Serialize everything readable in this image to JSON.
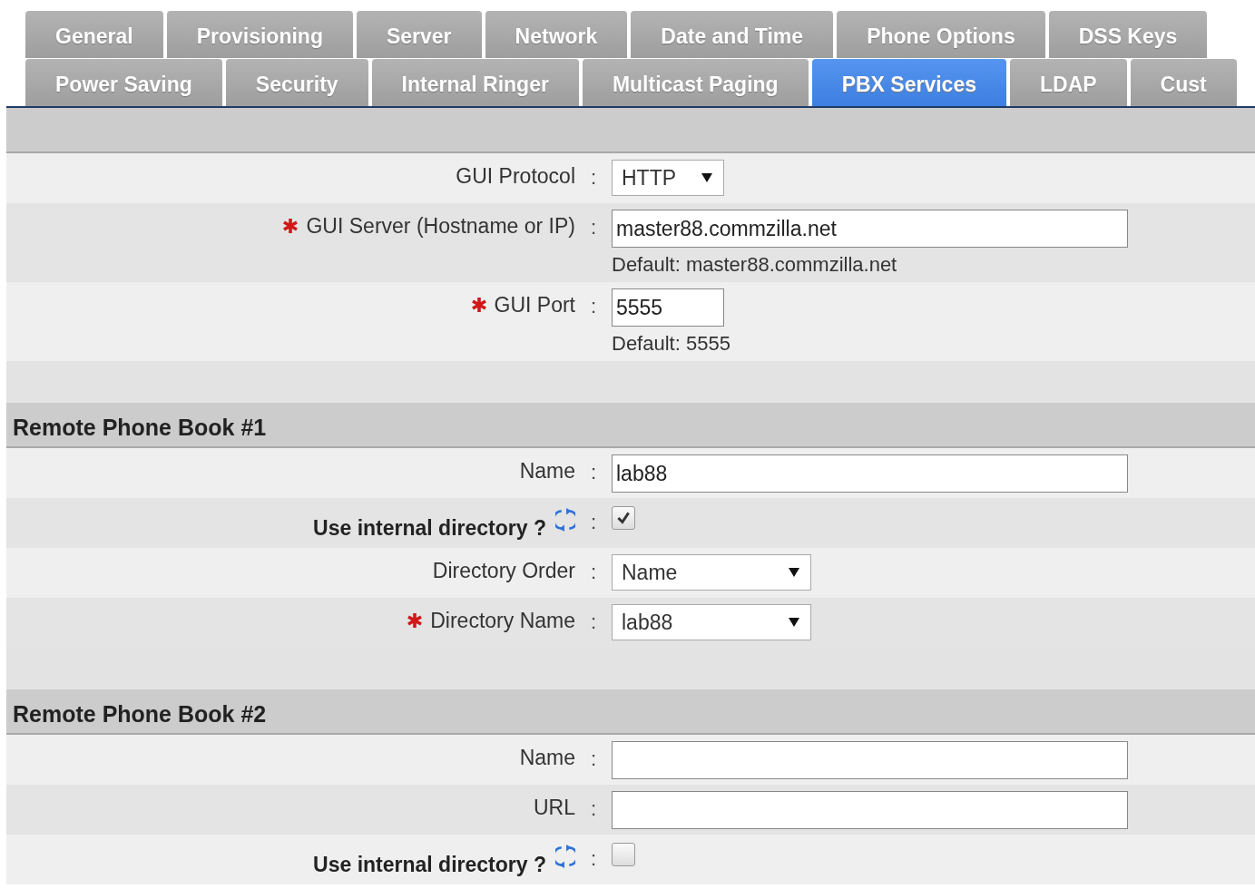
{
  "tabs": [
    [
      {
        "label": "General",
        "selected": false
      },
      {
        "label": "Provisioning",
        "selected": false
      },
      {
        "label": "Server",
        "selected": false
      },
      {
        "label": "Network",
        "selected": false
      },
      {
        "label": "Date and Time",
        "selected": false
      },
      {
        "label": "Phone Options",
        "selected": false
      },
      {
        "label": "DSS Keys",
        "selected": false
      }
    ],
    [
      {
        "label": "Power Saving",
        "selected": false
      },
      {
        "label": "Security",
        "selected": false
      },
      {
        "label": "Internal Ringer",
        "selected": false
      },
      {
        "label": "Multicast Paging",
        "selected": false
      },
      {
        "label": "PBX Services",
        "selected": true
      },
      {
        "label": "LDAP",
        "selected": false
      },
      {
        "label": "Cust",
        "selected": false
      }
    ]
  ],
  "sections": [
    {
      "fields": [
        {
          "kind": "select",
          "label": "GUI Protocol",
          "separator": ":",
          "required": false,
          "value": "HTTP"
        },
        {
          "kind": "text",
          "label": "GUI Server (Hostname or IP)",
          "separator": ":",
          "required": true,
          "value": "master88.commzilla.net",
          "hint": "Default: master88.commzilla.net"
        },
        {
          "kind": "number",
          "label": "GUI Port",
          "separator": ":",
          "required": true,
          "value": "5555",
          "hint": "Default: 5555"
        }
      ]
    },
    {
      "title": "Remote Phone Book #1",
      "fields": [
        {
          "kind": "text",
          "label": "Name",
          "separator": ":",
          "required": false,
          "value": "lab88"
        },
        {
          "kind": "checkbox",
          "label": "Use internal directory ?",
          "separator": ":",
          "checked": true
        },
        {
          "kind": "select",
          "label": "Directory Order",
          "separator": ":",
          "required": false,
          "value": "Name"
        },
        {
          "kind": "select",
          "label": "Directory Name",
          "separator": ":",
          "required": true,
          "value": "lab88"
        }
      ]
    },
    {
      "title": "Remote Phone Book #2",
      "fields": [
        {
          "kind": "text",
          "label": "Name",
          "separator": ":",
          "required": false
        },
        {
          "kind": "text",
          "label": "URL",
          "separator": ":",
          "required": false
        },
        {
          "kind": "checkbox",
          "label": "Use internal directory ?",
          "separator": ":",
          "checked": false
        }
      ]
    }
  ]
}
